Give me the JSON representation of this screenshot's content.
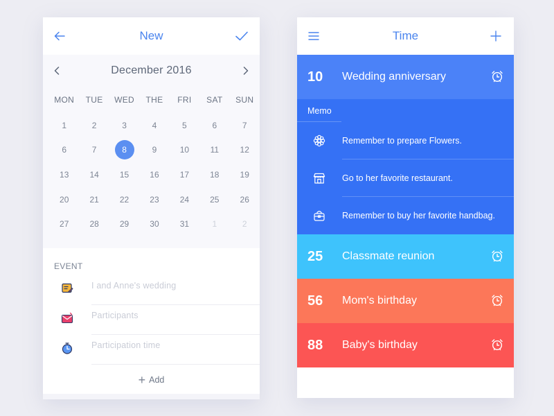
{
  "new_screen": {
    "title": "New",
    "back_icon": "arrow-left-icon",
    "confirm_icon": "checkmark-icon",
    "calendar": {
      "month_title": "December 2016",
      "weekdays": [
        "MON",
        "TUE",
        "WED",
        "THE",
        "FRI",
        "SAT",
        "SUN"
      ],
      "weeks": [
        [
          "1",
          "2",
          "3",
          "4",
          "5",
          "6",
          "7"
        ],
        [
          "6",
          "7",
          "8",
          "9",
          "10",
          "11",
          "12"
        ],
        [
          "13",
          "14",
          "15",
          "16",
          "17",
          "18",
          "19"
        ],
        [
          "20",
          "21",
          "22",
          "23",
          "24",
          "25",
          "26"
        ],
        [
          "27",
          "28",
          "29",
          "30",
          "31",
          "1",
          "2"
        ]
      ],
      "selected_day": "8"
    },
    "event": {
      "label": "EVENT",
      "fields": [
        {
          "placeholder": "I and Anne's wedding",
          "icon": "note-icon"
        },
        {
          "placeholder": "Participants",
          "icon": "mail-icon"
        },
        {
          "placeholder": "Participation time",
          "icon": "stopwatch-icon"
        }
      ],
      "add_label": "Add"
    }
  },
  "time_screen": {
    "title": "Time",
    "menu_icon": "hamburger-menu-icon",
    "add_icon": "plus-icon",
    "items": [
      {
        "days": "10",
        "name": "Wedding anniversary",
        "color": "#4b82f8"
      },
      {
        "days": "25",
        "name": "Classmate reunion",
        "color": "#3ec3fc"
      },
      {
        "days": "56",
        "name": "Mom's birthday",
        "color": "#fc7759"
      },
      {
        "days": "88",
        "name": "Baby's birthday",
        "color": "#fc5554"
      }
    ],
    "memo": {
      "label": "Memo",
      "color": "#3571f5",
      "items": [
        {
          "text": "Remember to prepare Flowers.",
          "icon": "flower-icon"
        },
        {
          "text": "Go to her favorite restaurant.",
          "icon": "store-icon"
        },
        {
          "text": "Remember to buy her favorite handbag.",
          "icon": "handbag-icon"
        }
      ]
    }
  }
}
